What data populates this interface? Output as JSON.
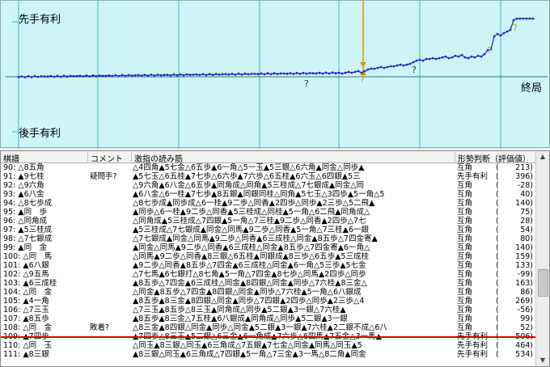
{
  "graph": {
    "label_top": "先手有利",
    "label_bottom": "後手有利",
    "label_end": "終局",
    "marker_glyph": "?"
  },
  "list": {
    "headers": [
      "棋譜",
      "コメント",
      "激指の読み筋",
      "形勢判断（評価値）"
    ],
    "rows": [
      {
        "move": "90: △8五角",
        "comment": "",
        "pv": "△4四角▲5七金△6五歩▲6一角△5一玉▲5三銀△6六角▲同金△同歩▲",
        "judge": "互角",
        "eval": "213)"
      },
      {
        "move": "91: ▲9七桂",
        "comment": "疑問手?",
        "pv": "▲5七玉△6五桂▲7七歩△6六歩▲7六歩△6五桂▲6六玉△6四銀▲5三",
        "judge": "先手有利",
        "eval": "396)"
      },
      {
        "move": "92: △9六角",
        "comment": "",
        "pv": "△9六角▲6八金△6五歩▲同角成△同角▲5三桂成△7七銀成▲同金△同",
        "judge": "互角",
        "eval": "-28)"
      },
      {
        "move": "93: ▲6八金",
        "comment": "",
        "pv": "▲6八金△6一桂▲7七歩▲8五銀▲同銀同桂△同角▲5七玉△3四歩▲5一角△5",
        "judge": "互角",
        "eval": "40)"
      },
      {
        "move": "94: △8七歩成",
        "comment": "",
        "pv": "△8七歩成▲同歩成△6一桂▲9二歩△同香▲2四歩△同歩▲2三歩△5二飛▲",
        "judge": "互角",
        "eval": "140)"
      },
      {
        "move": "95: ▲同　歩",
        "comment": "",
        "pv": "▲同歩△6一桂▲9二歩△同香▲5三桂成△同桂▲5一角△6二飛▲同角成△",
        "judge": "互角",
        "eval": "75)"
      },
      {
        "move": "96: △同角成",
        "comment": "",
        "pv": "△同角成▲5三桂成△7四銀▲5一角△7三桂▲9二歩△同香▲2四歩△7七",
        "judge": "互角",
        "eval": "28)"
      },
      {
        "move": "97: ▲5三桂成",
        "comment": "",
        "pv": "▲5三桂成△7七銀成▲同金△同馬▲9二歩△同香▲5一角△7三桂▲6一銀",
        "judge": "互角",
        "eval": "54)"
      },
      {
        "move": "98: △7七銀成",
        "comment": "",
        "pv": "△7七銀成▲同金△同馬▲9二歩△同香▲6三成桂△同金▲8五歩△7四金寄▲",
        "judge": "互角",
        "eval": "80)"
      },
      {
        "move": "99: ▲同　金",
        "comment": "",
        "pv": "▲同金△同馬▲9二歩△同香▲6三成桂△同金▲8五歩△7四金寄▲6一角△",
        "judge": "互角",
        "eval": "140)"
      },
      {
        "move": "100: △同　馬",
        "comment": "",
        "pv": "△同馬▲9二歩△同香▲8三銀△6五桂▲同銀成▲8三歩△6五歩▲5三成桂",
        "judge": "互角",
        "eval": "159)"
      },
      {
        "move": "101: ▲6八銀",
        "comment": "",
        "pv": "▲9二歩△同香▲8五歩△7四金▲6三成桂△同金▲6一角△5三歩▲5七金",
        "judge": "互角",
        "eval": "133)"
      },
      {
        "move": "102: △9五馬",
        "comment": "",
        "pv": "△7七馬▲6七銀打△8七角▲5一角△7四金▲8七歩△同馬▲2四歩△同歩",
        "judge": "互角",
        "eval": "-99)"
      },
      {
        "move": "103: ▲6三成桂",
        "comment": "",
        "pv": "▲8五歩△7四金▲6三成桂△同金▲8四銀△同金▲同歩△7六桂▲8三金△",
        "judge": "互角",
        "eval": "163)"
      },
      {
        "move": "104: △同　金",
        "comment": "",
        "pv": "△同金▲8五歩△7四金▲8四銀△同金▲同歩△7六桂▲5一角△6八銀成",
        "judge": "互角",
        "eval": "86)"
      },
      {
        "move": "105: ▲4一角",
        "comment": "",
        "pv": "▲8五歩▲8三金▲8四銀△同金▲同歩△7四銀▲2四歩△同歩▲2三歩△4",
        "judge": "互角",
        "eval": "269)"
      },
      {
        "move": "106: △7三玉",
        "comment": "",
        "pv": "△7三玉▲8五歩△8三玉▲同角成△同歩▲5二銀▲3一銀△7六桂▲",
        "judge": "互角",
        "eval": "-56)"
      },
      {
        "move": "107: ▲8五歩",
        "comment": "",
        "pv": "▲8五歩▲8三金△7五桂▲6八銀成▲同角成△同歩▲5二銀▲3一銀",
        "judge": "互角",
        "eval": "99)"
      },
      {
        "move": "108: △同　金",
        "comment": "敗着?",
        "pv": "△8三金▲8四銀△同金▲同歩△同金▲5二銀▲3一銀▲7六桂▲2二銀不成△6八",
        "judge": "互角",
        "eval": "52)"
      },
      {
        "move": "109: ▲7四歩",
        "comment": "",
        "pv": "▲7四歩△8三玉▲5二銀△6三金▲6一角成▲7六歩△6四馬▲7五金△3一馬▲",
        "judge": "先手有利",
        "eval": "506)"
      },
      {
        "move": "110: △同　玉",
        "comment": "",
        "pv": "△同玉▲8三銀△同玉▲6三角成△7五銀▲7七金△同金▲同馬△同玉▲5",
        "judge": "先手有利",
        "eval": "464)"
      },
      {
        "move": "111: ▲8三銀",
        "comment": "",
        "pv": "▲8三銀△同玉▲6三角成△7四銀▲5一角△7三金▲3一馬△8二角▲同金",
        "judge": "先手有利",
        "eval": "534)"
      }
    ]
  },
  "colors": {
    "graph_bg": "#cdf5f7",
    "series": "#2a2ac0",
    "marker": "#e09000",
    "selection_line": "#e00000"
  }
}
